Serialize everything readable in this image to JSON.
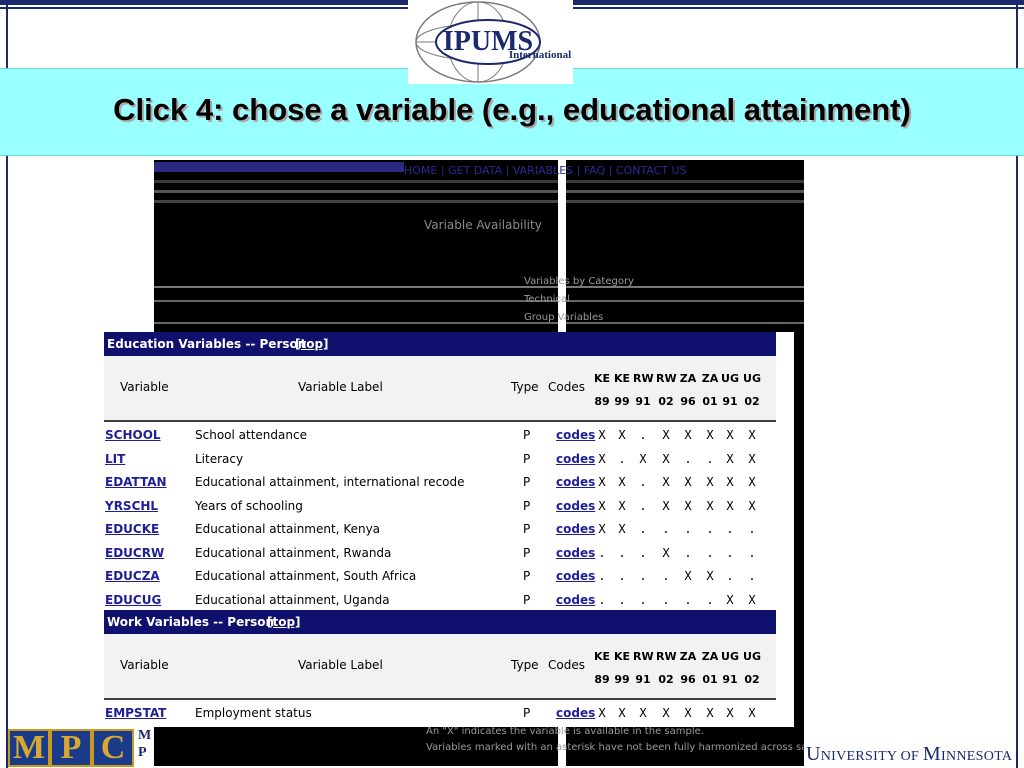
{
  "slide": {
    "title": "Click 4:  chose a variable (e.g., educational attainment)",
    "logo_text": "IPUMS",
    "logo_subtext": "International",
    "bottom_left_logo": "MPC",
    "bottom_left_small": [
      "M",
      "P"
    ],
    "university_first": "U",
    "university_rest": "NIVERSITY OF ",
    "university_m": "M",
    "university_tail": "INNESOTA"
  },
  "background_screen": {
    "nav": "HOME | GET DATA | VARIABLES | FAQ | CONTACT US",
    "heading": "Variable Availability",
    "info_lines": [
      "Variables by Category",
      "Technical",
      "Group Variables"
    ],
    "footer_lines": [
      "An \"X\" indicates the variable is available in the sample.",
      "Variables marked with an asterisk have not been fully harmonized across samples."
    ]
  },
  "table": {
    "columns": {
      "variable": "Variable",
      "label": "Variable Label",
      "type": "Type",
      "codes": "Codes",
      "countries": [
        "KE",
        "KE",
        "RW",
        "RW",
        "ZA",
        "ZA",
        "UG",
        "UG"
      ],
      "years": [
        "89",
        "99",
        "91",
        "02",
        "96",
        "01",
        "91",
        "02"
      ]
    },
    "sections": [
      {
        "title": "Education Variables -- Person",
        "top_link": "[top]",
        "rows": [
          {
            "var": "SCHOOL",
            "label": "School attendance",
            "type": "P",
            "codes": "codes",
            "avail": [
              "X",
              "X",
              ".",
              "X",
              "X",
              "X",
              "X",
              "X"
            ]
          },
          {
            "var": "LIT",
            "label": "Literacy",
            "type": "P",
            "codes": "codes",
            "avail": [
              "X",
              ".",
              "X",
              "X",
              ".",
              ".",
              "X",
              "X"
            ]
          },
          {
            "var": "EDATTAN",
            "label": "Educational attainment, international recode",
            "type": "P",
            "codes": "codes",
            "avail": [
              "X",
              "X",
              ".",
              "X",
              "X",
              "X",
              "X",
              "X"
            ]
          },
          {
            "var": "YRSCHL",
            "label": "Years of schooling",
            "type": "P",
            "codes": "codes",
            "avail": [
              "X",
              "X",
              ".",
              "X",
              "X",
              "X",
              "X",
              "X"
            ]
          },
          {
            "var": "EDUCKE",
            "label": "Educational attainment, Kenya",
            "type": "P",
            "codes": "codes",
            "avail": [
              "X",
              "X",
              ".",
              ".",
              ".",
              ".",
              ".",
              "."
            ]
          },
          {
            "var": "EDUCRW",
            "label": "Educational attainment, Rwanda",
            "type": "P",
            "codes": "codes",
            "avail": [
              ".",
              ".",
              ".",
              "X",
              ".",
              ".",
              ".",
              "."
            ]
          },
          {
            "var": "EDUCZA",
            "label": "Educational attainment, South Africa",
            "type": "P",
            "codes": "codes",
            "avail": [
              ".",
              ".",
              ".",
              ".",
              "X",
              "X",
              ".",
              "."
            ]
          },
          {
            "var": "EDUCUG",
            "label": "Educational attainment, Uganda",
            "type": "P",
            "codes": "codes",
            "avail": [
              ".",
              ".",
              ".",
              ".",
              ".",
              ".",
              "X",
              "X"
            ]
          }
        ]
      },
      {
        "title": "Work Variables -- Person",
        "top_link": "[top]",
        "rows": [
          {
            "var": "EMPSTAT",
            "label": "Employment status",
            "type": "P",
            "codes": "codes",
            "avail": [
              "X",
              "X",
              "X",
              "X",
              "X",
              "X",
              "X",
              "X"
            ]
          }
        ]
      }
    ]
  },
  "colors": {
    "title_band": "#99ffff",
    "section_bar": "#10106e",
    "link": "#1e1e99",
    "frame": "#1a2a6c"
  }
}
